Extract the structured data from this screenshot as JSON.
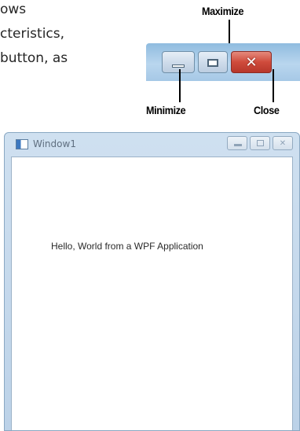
{
  "doc_text": {
    "lines": [
      "ows",
      "cteristics,",
      "button, as"
    ]
  },
  "callouts": {
    "maximize": "Maximize",
    "minimize": "Minimize",
    "close": "Close"
  },
  "zoomed_buttons": {
    "close_glyph": "✕"
  },
  "window": {
    "title": "Window1",
    "content_text": "Hello, World from a WPF Application",
    "caption_close_glyph": "✕"
  }
}
